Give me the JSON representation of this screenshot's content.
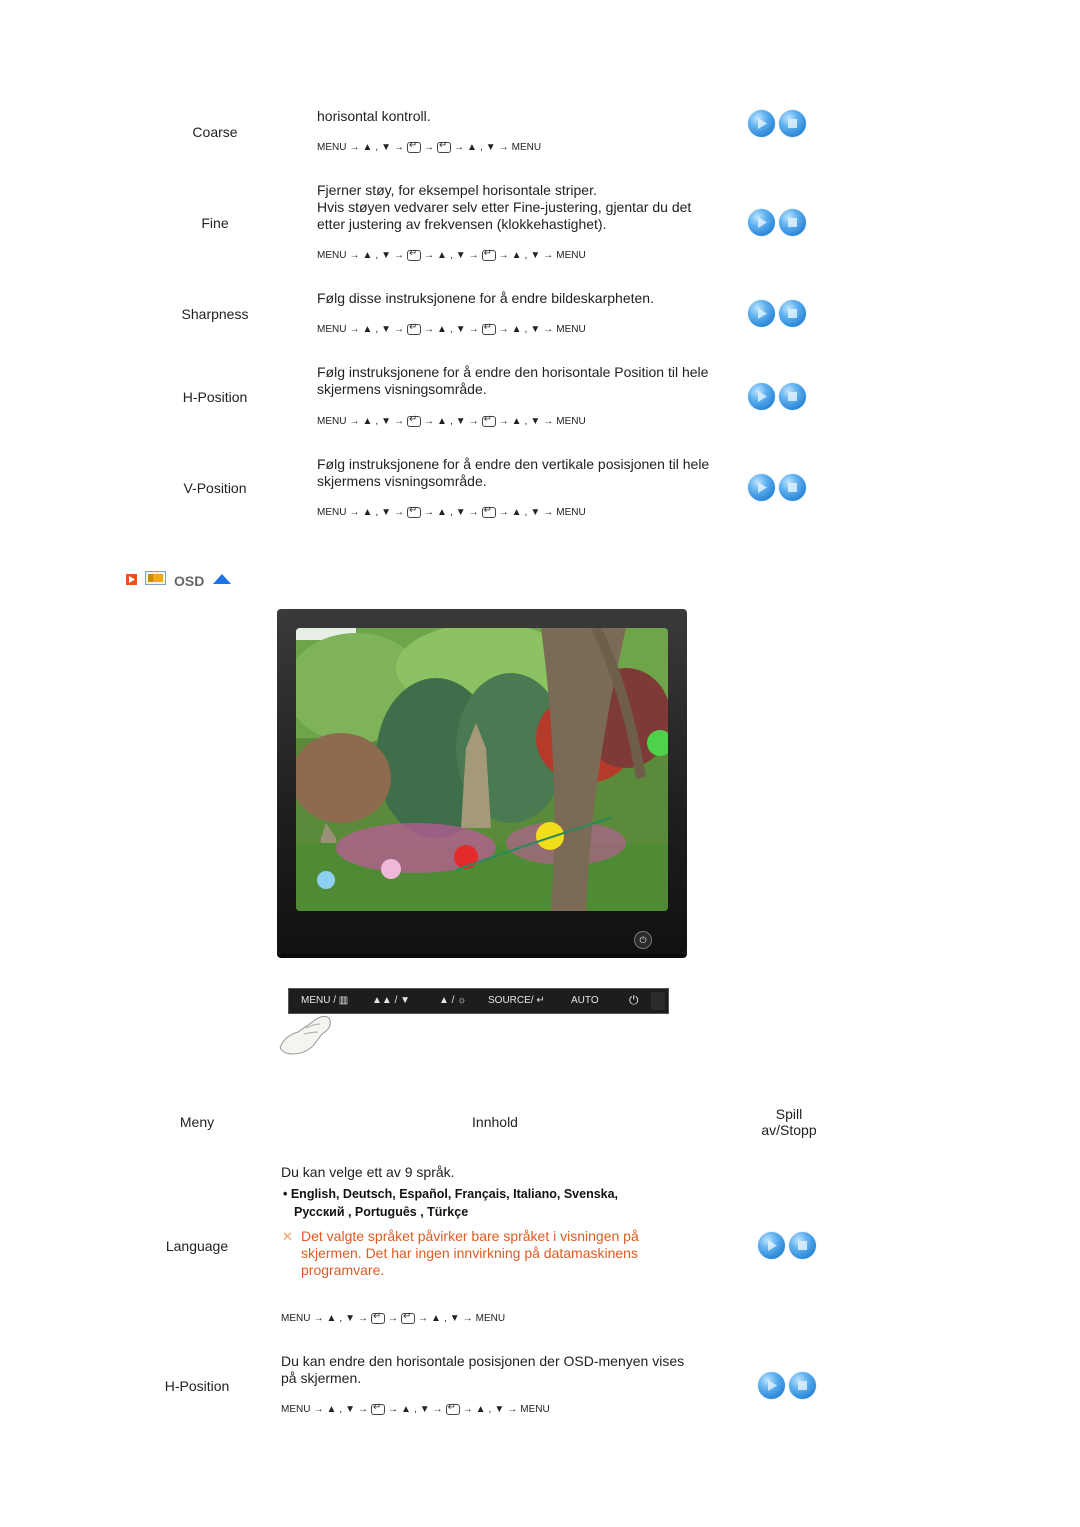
{
  "picture_rows": [
    {
      "label": "Coarse",
      "description": "horisontal kontroll.",
      "sequence": [
        "MENU",
        "→",
        "▲",
        ",",
        "▼",
        "→",
        "ENTER",
        "→",
        "ENTER",
        "→",
        "▲",
        ",",
        "▼",
        "→",
        "MENU"
      ]
    },
    {
      "label": "Fine",
      "description": "Fjerner støy, for eksempel horisontale striper.\nHvis støyen vedvarer selv etter Fine-justering, gjentar du det etter justering av frekvensen (klokkehastighet).",
      "sequence": [
        "MENU",
        "→",
        "▲",
        ",",
        "▼",
        "→",
        "ENTER",
        "→",
        "▲",
        ",",
        "▼",
        "→",
        "ENTER",
        "→",
        "▲",
        ",",
        "▼",
        "→",
        "MENU"
      ]
    },
    {
      "label": "Sharpness",
      "description": "Følg disse instruksjonene for å endre bildeskarpheten.",
      "sequence": [
        "MENU",
        "→",
        "▲",
        ",",
        "▼",
        "→",
        "ENTER",
        "→",
        "▲",
        ",",
        "▼",
        "→",
        "ENTER",
        "→",
        "▲",
        ",",
        "▼",
        "→",
        "MENU"
      ]
    },
    {
      "label": "H-Position",
      "description": "Følg instruksjonene for å endre den horisontale Position til hele skjermens visningsområde.",
      "sequence": [
        "MENU",
        "→",
        "▲",
        ",",
        "▼",
        "→",
        "ENTER",
        "→",
        "▲",
        ",",
        "▼",
        "→",
        "ENTER",
        "→",
        "▲",
        ",",
        "▼",
        "→",
        "MENU"
      ]
    },
    {
      "label": "V-Position",
      "description": "Følg instruksjonene for å endre den vertikale posisjonen til hele skjermens visningsområde.",
      "sequence": [
        "MENU",
        "→",
        "▲",
        ",",
        "▼",
        "→",
        "ENTER",
        "→",
        "▲",
        ",",
        "▼",
        "→",
        "ENTER",
        "→",
        "▲",
        ",",
        "▼",
        "→",
        "MENU"
      ]
    }
  ],
  "osd_section": {
    "title": "OSD",
    "icons": [
      "play-marker-icon",
      "osd-menu-icon",
      "up-triangle-icon"
    ]
  },
  "monitor_image": {
    "alt": "Monitor showing garden with pagoda and lanterns"
  },
  "control_bar": {
    "buttons": [
      "MENU / ▥",
      "▲▲ / ▼",
      "▲ / ☼",
      "SOURCE/ ↵",
      "AUTO",
      "⏻"
    ]
  },
  "table_header": {
    "menu": "Meny",
    "content": "Innhold",
    "play_stop_line1": "Spill",
    "play_stop_line2": "av/Stopp"
  },
  "osd_rows": [
    {
      "label": "Language",
      "description": "Du kan velge ett av 9 språk.",
      "languages_line1": "• English, Deutsch, Español, Français,  Italiano, Svenska,",
      "languages_line2": "Русский , Português , Türkçe",
      "note": "Det valgte språket påvirker bare språket i visningen på skjermen. Det har ingen innvirkning på datamaskinens programvare.",
      "note_icon": "✕",
      "sequence": [
        "MENU",
        "→",
        "▲",
        ",",
        "▼",
        "→",
        "ENTER",
        "→",
        "ENTER",
        "→",
        "▲",
        ",",
        "▼",
        "→",
        "MENU"
      ]
    },
    {
      "label": "H-Position",
      "description": "Du kan endre den horisontale posisjonen der OSD-menyen vises på skjermen.",
      "sequence": [
        "MENU",
        "→",
        "▲",
        ",",
        "▼",
        "→",
        "ENTER",
        "→",
        "▲",
        ",",
        "▼",
        "→",
        "ENTER",
        "→",
        "▲",
        ",",
        "▼",
        "→",
        "MENU"
      ]
    }
  ],
  "colors": {
    "note_text": "#e05a20",
    "button_blue": "#2a86d6",
    "osd_title": "#666666",
    "osd_arrow": "#1a73e8",
    "play_marker": "#e8531c"
  }
}
